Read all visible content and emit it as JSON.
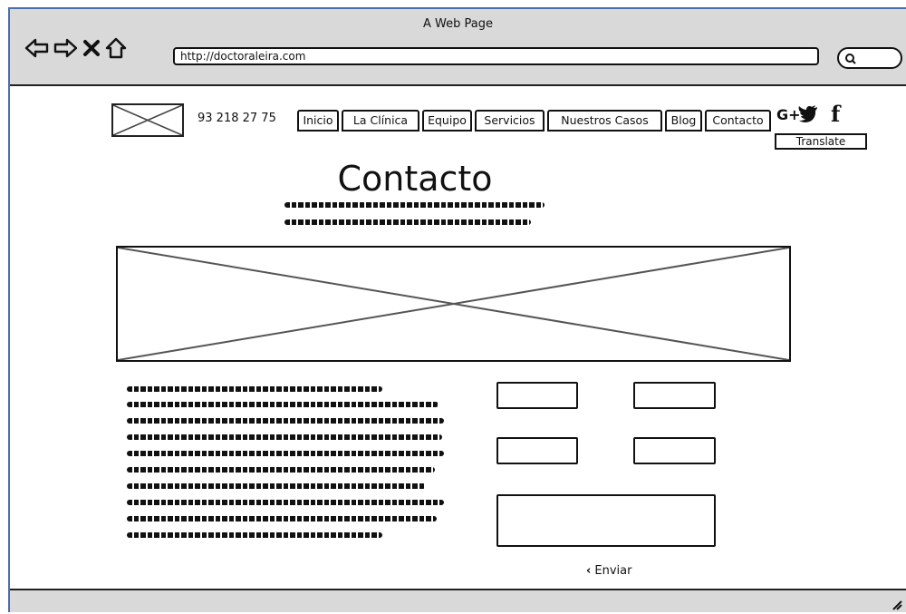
{
  "browser": {
    "window_title": "A Web Page",
    "url": "http://doctoraleira.com"
  },
  "header": {
    "phone": "93 218 27 75",
    "nav": [
      "Inicio",
      "La Clínica",
      "Equipo",
      "Servicios",
      "Nuestros Casos",
      "Blog",
      "Contacto"
    ],
    "social": {
      "google_plus": "G+",
      "twitter_icon": "twitter-icon",
      "facebook": "f"
    },
    "translate_label": "Translate"
  },
  "main": {
    "title": "Contacto",
    "send_label": "Enviar"
  },
  "colors": {
    "chrome": "#d9d9d9",
    "frame_border": "#4a6fa8",
    "ink": "#111111"
  }
}
